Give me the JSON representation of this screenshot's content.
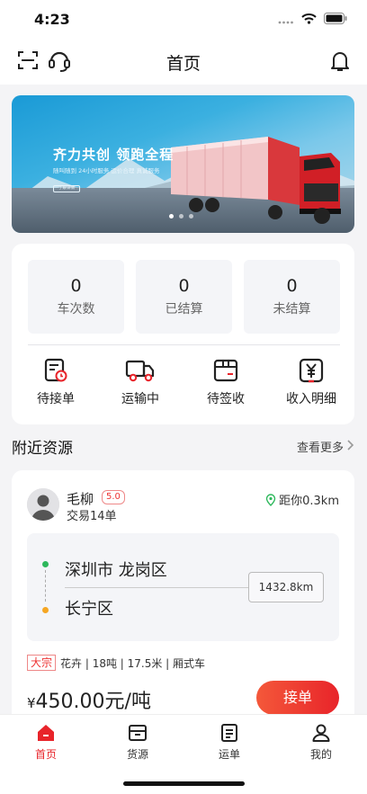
{
  "status_bar": {
    "time": "4:23"
  },
  "header": {
    "title": "首页"
  },
  "banner": {
    "title": "齐力共创 领跑全程",
    "subtitle": "随叫随到  24小时服务  运价合理  真诚服务",
    "button": "了解详情"
  },
  "stats": [
    {
      "value": "0",
      "label": "车次数"
    },
    {
      "value": "0",
      "label": "已结算"
    },
    {
      "value": "0",
      "label": "未结算"
    }
  ],
  "actions": [
    {
      "label": "待接单",
      "icon": "order-pending-icon"
    },
    {
      "label": "运输中",
      "icon": "truck-icon"
    },
    {
      "label": "待签收",
      "icon": "box-icon"
    },
    {
      "label": "收入明细",
      "icon": "yuan-receipt-icon"
    }
  ],
  "nearby": {
    "title": "附近资源",
    "more": "查看更多",
    "card": {
      "name": "毛柳",
      "rating": "5.0",
      "trades": "交易14单",
      "distance": "距你0.3km",
      "from": "深圳市 龙岗区",
      "to": "长宁区",
      "route_distance": "1432.8km",
      "tag": "大宗",
      "cargo": "花卉 | 18吨 | 17.5米 | 厢式车",
      "currency": "¥",
      "price": "450.00元/吨",
      "accept_label": "接单"
    }
  },
  "tabs": [
    {
      "label": "首页",
      "active": true
    },
    {
      "label": "货源",
      "active": false
    },
    {
      "label": "运单",
      "active": false
    },
    {
      "label": "我的",
      "active": false
    }
  ],
  "colors": {
    "accent": "#e8242a",
    "route_start": "#2eb85c",
    "route_end": "#f5a623"
  }
}
